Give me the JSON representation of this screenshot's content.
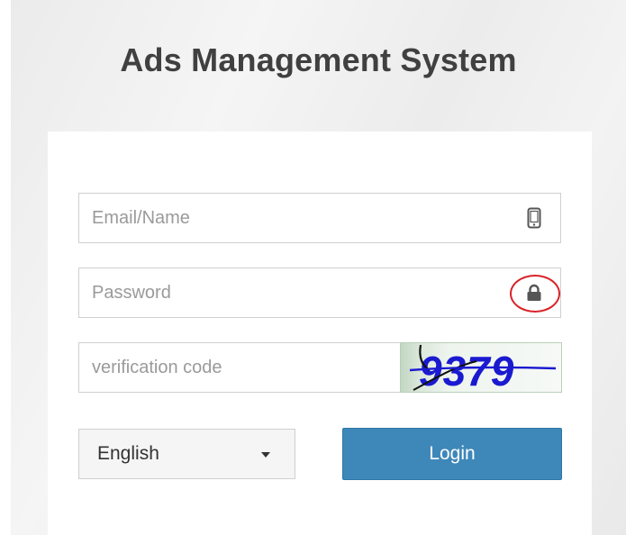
{
  "page": {
    "title": "Ads Management System"
  },
  "form": {
    "email": {
      "placeholder": "Email/Name",
      "value": "",
      "icon": "mobile-phone-icon"
    },
    "password": {
      "placeholder": "Password",
      "value": "",
      "icon": "lock-icon"
    },
    "verification": {
      "placeholder": "verification code",
      "value": ""
    },
    "captcha": {
      "text": "9379",
      "color": "#1a1ad0"
    },
    "language": {
      "selected": "English",
      "icon": "caret-down-icon"
    },
    "login_label": "Login"
  },
  "colors": {
    "primary": "#3e87b9",
    "highlight": "#d8232a"
  }
}
